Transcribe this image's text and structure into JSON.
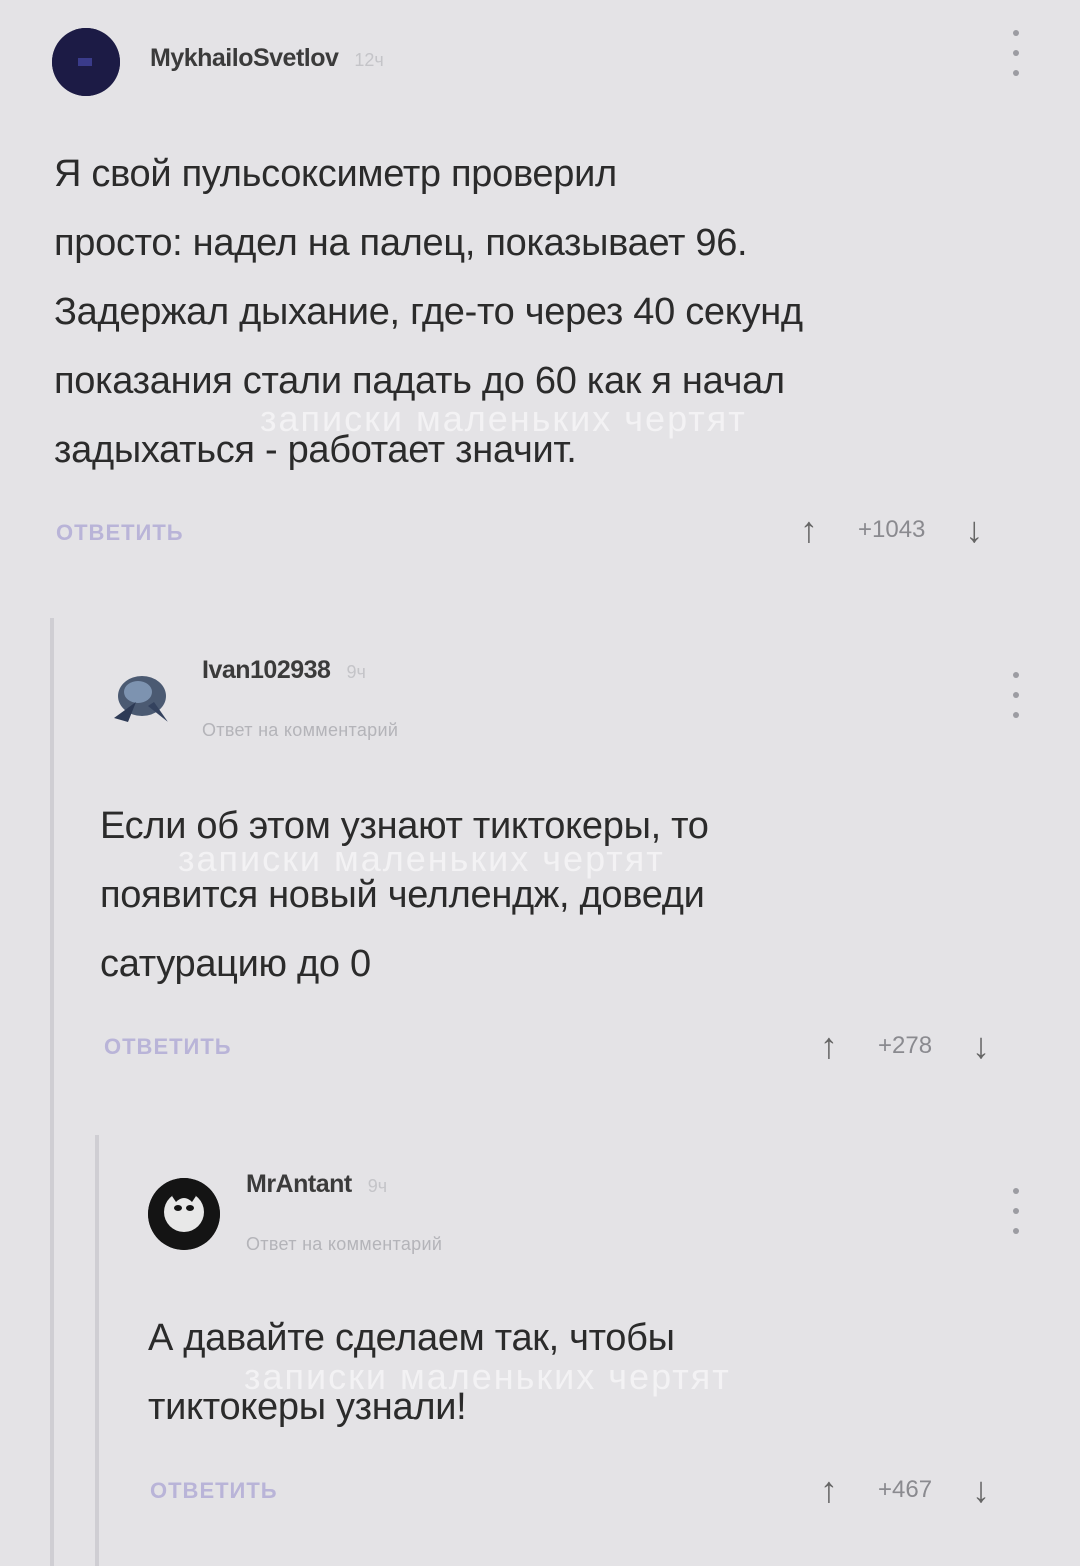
{
  "comments": [
    {
      "author": "MykhailoSvetlov",
      "time": "12ч",
      "reply_to": "",
      "text_lines": [
        "Я свой пульсоксиметр проверил",
        "просто: надел на палец, показывает 96.",
        "Задержал дыхание, где-то через 40 секунд",
        "показания стали падать до 60 как я начал",
        "задыхаться - работает значит."
      ],
      "reply_label": "ОТВЕТИТЬ",
      "score": "+1043",
      "upvote_icon": "↑",
      "downvote_icon": "↓"
    },
    {
      "author": "Ivan102938",
      "time": "9ч",
      "reply_to": "Ответ на комментарий",
      "text_lines": [
        "Если об этом узнают тиктокеры, то",
        "появится новый челлендж, доведи",
        "сатурацию до 0"
      ],
      "reply_label": "ОТВЕТИТЬ",
      "score": "+278",
      "upvote_icon": "↑",
      "downvote_icon": "↓"
    },
    {
      "author": "MrAntant",
      "time": "9ч",
      "reply_to": "Ответ на комментарий",
      "text_lines": [
        "А давайте сделаем так, чтобы",
        "тиктокеры узнали!"
      ],
      "reply_label": "ОТВЕТИТЬ",
      "score": "+467",
      "upvote_icon": "↑",
      "downvote_icon": "↓"
    }
  ],
  "watermark": "записки маленьких чертят",
  "colors": {
    "background": "#e4e3e6",
    "reply_button": "#b9b4d8",
    "thread_line": "#cfced3"
  }
}
